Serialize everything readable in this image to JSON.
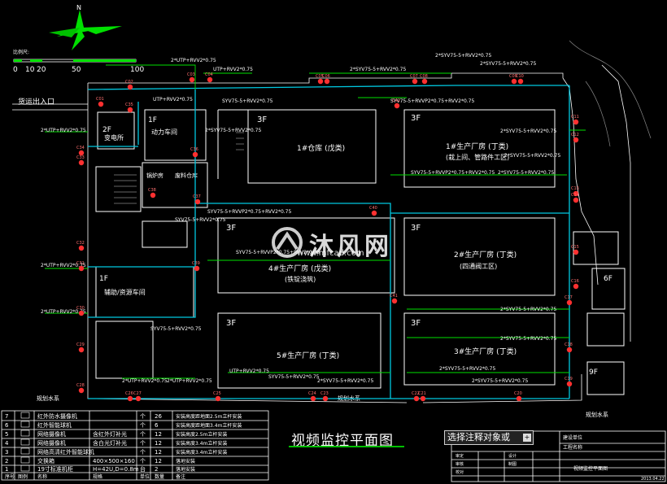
{
  "compass": {
    "north": "N"
  },
  "scale_bar": {
    "label": "比例尺:",
    "ticks": [
      "0",
      "10",
      "20",
      "50",
      "100"
    ]
  },
  "title": "视频监控平面图",
  "command_prompt": {
    "value": "选择注释对象或"
  },
  "watermark": {
    "brand": "沐风网",
    "url": "www.mfcad.com"
  },
  "site": {
    "entrance": "货运出入口",
    "water_left": "规划水系",
    "water_bottom": "规划水系",
    "water_right": "规划水系"
  },
  "buildings": [
    {
      "name": "1#仓库 (戊类)",
      "floors": "3F"
    },
    {
      "name": "1#生产厂房 (丁类)",
      "sub": "(栽上间、管路件工区)",
      "floors": "3F"
    },
    {
      "name": "2#生产厂房 (丁类)",
      "sub": "(四通阀工区)",
      "floors": "3F"
    },
    {
      "name": "4#生产厂房 (戊类)",
      "sub": "(铁锭浇筑)",
      "floors": "3F"
    },
    {
      "name": "5#生产厂房 (丁类)",
      "floors": "3F"
    },
    {
      "name": "3#生产厂房 (丁类)",
      "floors": "3F"
    },
    {
      "name": "动力车间",
      "floors": "1F"
    },
    {
      "name": "变电所",
      "floors": "2F"
    },
    {
      "name": "辅助/资源车间",
      "floors": "1F"
    },
    {
      "name": "锅炉房",
      "floors": ""
    },
    {
      "name": "废料仓库",
      "floors": ""
    },
    {
      "name": "9F",
      "floors": "9F"
    },
    {
      "name": "6F",
      "floors": "6F"
    }
  ],
  "cable_labels": [
    "2*UTP+RVV2*0.75",
    "UTP+RVV2*0.75",
    "2*SYV75-5+RVV2*0.75",
    "SYV75-5+RVV2*0.75",
    "SYV75-5+RVVP2*0.75+RVV2*0.75"
  ],
  "camera_ids": [
    "C01",
    "C02",
    "C03",
    "C04",
    "C05",
    "C06",
    "C07",
    "C08",
    "C09",
    "C10",
    "C11",
    "C12",
    "C13",
    "C14",
    "C15",
    "C16",
    "C17",
    "C18",
    "C19",
    "C20",
    "C21",
    "C22",
    "C23",
    "C24",
    "C25",
    "C26",
    "C27",
    "C28",
    "C29",
    "C30",
    "C31",
    "C32",
    "C33",
    "C34",
    "C35",
    "C36",
    "C37",
    "C38",
    "C39",
    "C40",
    "C41",
    "C42"
  ],
  "legend": {
    "headers": [
      "序号",
      "图例",
      "名称",
      "规格",
      "单位",
      "数量",
      "备注"
    ],
    "rows": [
      [
        "7",
        "",
        "红外防水摄像机",
        "",
        "个",
        "26",
        "安装高度距地面2.5m立杆安装"
      ],
      [
        "6",
        "",
        "红外智能球机",
        "",
        "个",
        "6",
        "安装高度距地面3.4m立杆安装"
      ],
      [
        "5",
        "",
        "网络摄像机",
        "含红外灯补光",
        "个",
        "12",
        "安装高度2.5m立杆安装"
      ],
      [
        "4",
        "",
        "网络摄像机",
        "含白光灯补光",
        "个",
        "12",
        "安装高度3.4m立杆安装"
      ],
      [
        "3",
        "",
        "网络高清红外智能球机",
        "",
        "个",
        "12",
        "安装高度3.4m立杆安装"
      ],
      [
        "2",
        "",
        "交换箱",
        "400×500×160",
        "个",
        "12",
        "落地安装"
      ],
      [
        "1",
        "",
        "19寸标准机柜",
        "H=42U,D=0.8m",
        "台",
        "2",
        "落地安装"
      ]
    ]
  },
  "title_block": {
    "project": "建设单位",
    "project_name": "工程名称",
    "drawing": "视频监控平面图",
    "date": "2013.04.22",
    "rows": [
      "审定",
      "审核",
      "校对",
      "设计",
      "制图"
    ]
  },
  "colors": {
    "building": "#ffffff",
    "cable": "#00c8e0",
    "green": "#00e000",
    "camera": "#ff3030",
    "background": "#000000"
  }
}
